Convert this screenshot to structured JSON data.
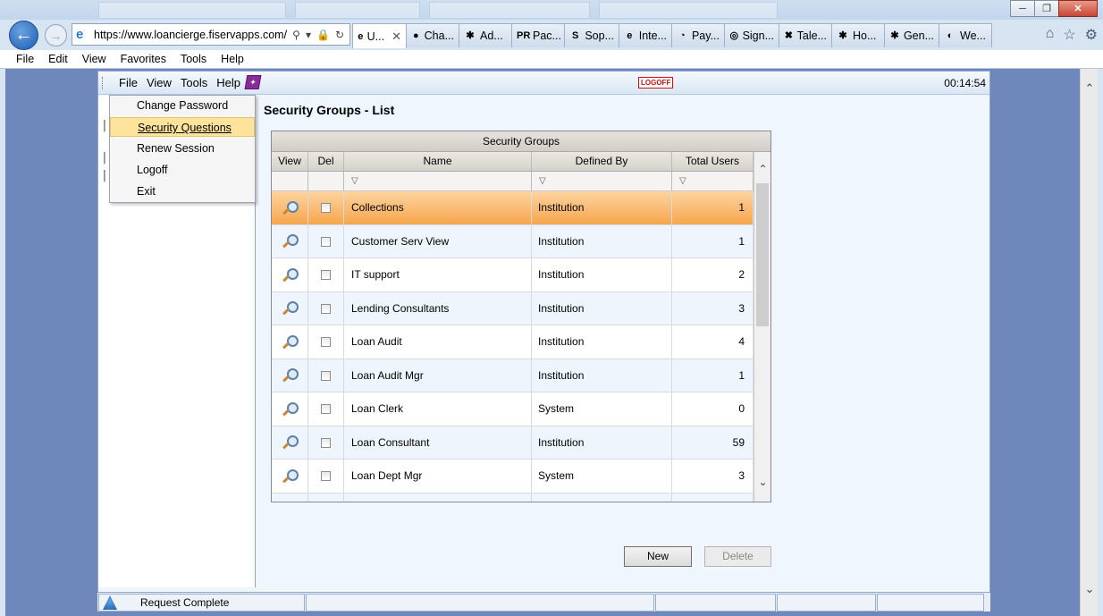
{
  "browser": {
    "url": "https://www.loancierge.fiservapps.com/",
    "tabs": [
      {
        "label": "U...",
        "icon": "ie-icon",
        "active": true
      },
      {
        "label": "Cha...",
        "icon": "chat-icon"
      },
      {
        "label": "Ad...",
        "icon": "ad-icon"
      },
      {
        "label": "Pac...",
        "icon": "pr-icon"
      },
      {
        "label": "Sop...",
        "icon": "s-icon"
      },
      {
        "label": "Inte...",
        "icon": "ie-icon"
      },
      {
        "label": "Pay...",
        "icon": "pay-icon"
      },
      {
        "label": "Sign...",
        "icon": "sign-icon"
      },
      {
        "label": "Tale...",
        "icon": "tale-icon"
      },
      {
        "label": "Ho...",
        "icon": "home-tab-icon"
      },
      {
        "label": "Gen...",
        "icon": "gen-icon"
      },
      {
        "label": "We...",
        "icon": "web-icon"
      }
    ],
    "menu": [
      "File",
      "Edit",
      "View",
      "Favorites",
      "Tools",
      "Help"
    ]
  },
  "app": {
    "menu": [
      "File",
      "View",
      "Tools",
      "Help"
    ],
    "logoff_label": "LOGOFF",
    "timer": "00:14:54",
    "file_menu": {
      "items": [
        "Change Password",
        "Security Questions",
        "Renew Session",
        "Logoff",
        "Exit"
      ],
      "highlighted": "Security Questions"
    }
  },
  "page": {
    "title": "Security Groups - List",
    "grid": {
      "caption": "Security Groups",
      "columns": [
        "View",
        "Del",
        "Name",
        "Defined By",
        "Total Users"
      ],
      "rows": [
        {
          "name": "Collections",
          "defined_by": "Institution",
          "total_users": "1"
        },
        {
          "name": "Customer Serv View",
          "defined_by": "Institution",
          "total_users": "1"
        },
        {
          "name": "IT support",
          "defined_by": "Institution",
          "total_users": "2"
        },
        {
          "name": "Lending Consultants",
          "defined_by": "Institution",
          "total_users": "3"
        },
        {
          "name": "Loan Audit",
          "defined_by": "Institution",
          "total_users": "4"
        },
        {
          "name": "Loan Audit Mgr",
          "defined_by": "Institution",
          "total_users": "1"
        },
        {
          "name": "Loan Clerk",
          "defined_by": "System",
          "total_users": "0"
        },
        {
          "name": "Loan Consultant",
          "defined_by": "Institution",
          "total_users": "59"
        },
        {
          "name": "Loan Dept Mgr",
          "defined_by": "System",
          "total_users": "3"
        }
      ],
      "selected_row": "Collections"
    },
    "buttons": {
      "new_label": "New",
      "delete_label": "Delete"
    }
  },
  "status": {
    "text": "Request Complete"
  },
  "colors": {
    "selected_row": "#f7a64e",
    "menu_highlight": "#fee39c",
    "page_bg": "#6e88bb"
  }
}
